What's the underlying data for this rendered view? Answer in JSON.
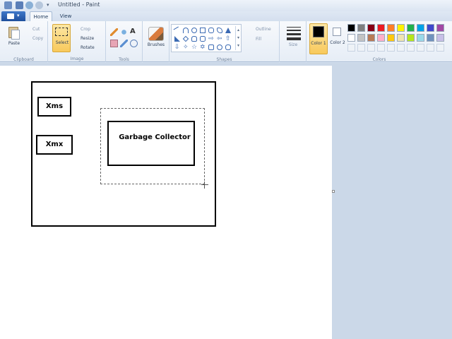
{
  "window": {
    "title": "Untitled - Paint"
  },
  "tabs": [
    {
      "label": "Home"
    },
    {
      "label": "View"
    }
  ],
  "ribbon": {
    "clipboard": {
      "label": "Clipboard",
      "paste": "Paste",
      "cut": "Cut",
      "copy": "Copy"
    },
    "image": {
      "label": "Image",
      "select": "Select",
      "crop": "Crop",
      "resize": "Resize",
      "rotate": "Rotate"
    },
    "tools": {
      "label": "Tools"
    },
    "brushes": {
      "label": "Brushes"
    },
    "shapes": {
      "label": "Shapes",
      "outline": "Outline",
      "fill": "Fill"
    },
    "size": {
      "label": "Size"
    },
    "colors": {
      "label": "Colors",
      "color1": "Color 1",
      "color2": "Color 2",
      "active_color": "#000000",
      "palette_row1": [
        "#000000",
        "#7f7f7f",
        "#880015",
        "#ed1c24",
        "#ff7f27",
        "#fff200",
        "#22b14c",
        "#00a2e8",
        "#3f48cc",
        "#a349a4"
      ],
      "palette_row2": [
        "#ffffff",
        "#c3c3c3",
        "#b97a57",
        "#ffaec9",
        "#ffc90e",
        "#efe4b0",
        "#b5e61d",
        "#99d9ea",
        "#7092be",
        "#c8bfe7"
      ]
    }
  },
  "canvas": {
    "labels": {
      "xms": "Xms",
      "xmx": "Xmx",
      "gc": "Garbage Collector"
    }
  }
}
